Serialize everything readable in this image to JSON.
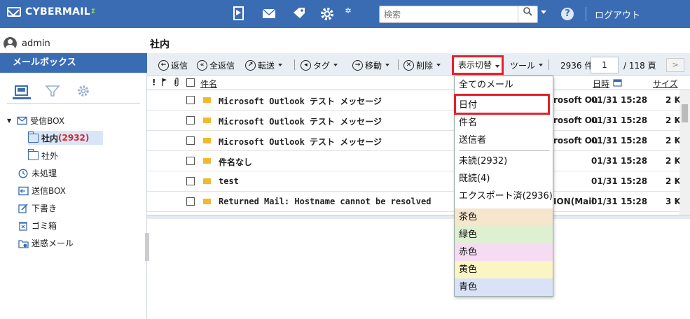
{
  "header": {
    "logo_text": "CYBERMAIL",
    "logo_suffix": "Σ",
    "search_placeholder": "検索",
    "logout": "ログアウト",
    "icons": [
      "address-book-icon",
      "mail-icon",
      "tag-icon",
      "settings-gear-icon"
    ]
  },
  "user": {
    "name": "admin"
  },
  "folder_title": "社内",
  "sidebar": {
    "title": "メールボックス",
    "tabs": [
      "mailbox-icon",
      "filter-icon",
      "gear-icon"
    ],
    "tree": [
      {
        "label": "受信BOX",
        "id": "inbox"
      },
      {
        "label": "社内",
        "count": "(2932)",
        "id": "internal"
      },
      {
        "label": "社外",
        "id": "external"
      },
      {
        "label": "未処理",
        "id": "pending"
      },
      {
        "label": "送信BOX",
        "id": "sent"
      },
      {
        "label": "下書き",
        "id": "drafts"
      },
      {
        "label": "ゴミ箱",
        "id": "trash"
      },
      {
        "label": "迷惑メール",
        "id": "spam"
      }
    ]
  },
  "toolbar": {
    "reply": "返信",
    "reply_all": "全返信",
    "forward": "転送",
    "tag": "タグ",
    "move": "移動",
    "delete": "削除",
    "display": "表示切替",
    "tools": "ツール",
    "count": "2936 件",
    "page": "1",
    "total_pages": "/ 118 頁",
    "next": ">"
  },
  "list": {
    "headers": {
      "flags": "! ",
      "subject": "件名",
      "date": "日時",
      "size": "サイズ"
    },
    "rows": [
      {
        "subject": "Microsoft Outlook テスト メッセージ",
        "from": "rosoft Ou",
        "date": "01/31 15:28",
        "size": "2 K"
      },
      {
        "subject": "Microsoft Outlook テスト メッセージ",
        "from": "rosoft Ou",
        "date": "01/31 15:28",
        "size": "2 K"
      },
      {
        "subject": "Microsoft Outlook テスト メッセージ",
        "from": "rosoft Ou",
        "date": "01/31 15:28",
        "size": "2 K"
      },
      {
        "subject": "件名なし",
        "from": "",
        "date": "01/31 15:28",
        "size": "2 K"
      },
      {
        "subject": "test",
        "from": "",
        "date": "01/31 15:28",
        "size": "2 K"
      },
      {
        "subject": "Returned Mail: Hostname cannot be resolved",
        "from": "ION(Mail",
        "date": "01/31 15:28",
        "size": "3 K"
      }
    ]
  },
  "dropdown": {
    "items": [
      {
        "label": "全てのメール"
      },
      {
        "label": "日付"
      },
      {
        "label": "件名"
      },
      {
        "label": "送信者"
      },
      {
        "label": "未読(2932)"
      },
      {
        "label": "既読(4)"
      },
      {
        "label": "エクスポート済(2936)"
      },
      {
        "label": "茶色",
        "color": "#f5e6cd"
      },
      {
        "label": "緑色",
        "color": "#dff0d2"
      },
      {
        "label": "赤色",
        "color": "#f6dcf3"
      },
      {
        "label": "黄色",
        "color": "#fbf4c3"
      },
      {
        "label": "青色",
        "color": "#d9e2f7"
      }
    ]
  },
  "colors": {
    "brand": "#3a6cb4",
    "highlight": "#e4212b",
    "unread_count": "#e0242a"
  }
}
